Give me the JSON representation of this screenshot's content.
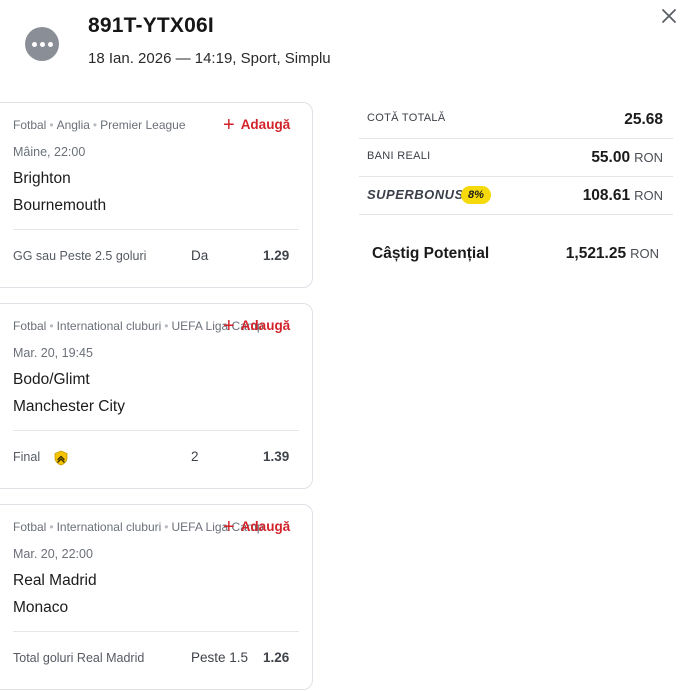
{
  "header": {
    "ticket_id": "891T-YTX06I",
    "subtitle": "18 Ian. 2026 — 14:19, Sport, Simplu"
  },
  "add_label": "Adaugă",
  "bets": [
    {
      "sport": "Fotbal",
      "country": "Anglia",
      "league": "Premier League",
      "time": "Mâine, 22:00",
      "team_a": "Brighton",
      "team_b": "Bournemouth",
      "market": "GG sau Peste 2.5 goluri",
      "pick": "Da",
      "odds": "1.29"
    },
    {
      "sport": "Fotbal",
      "country": "International cluburi",
      "league": "UEFA Liga Camp",
      "time": "Mar. 20, 19:45",
      "team_a": "Bodo/Glimt",
      "team_b": "Manchester City",
      "market": "Final",
      "market_icon": "boost-shield-icon",
      "pick": "2",
      "odds": "1.39"
    },
    {
      "sport": "Fotbal",
      "country": "International cluburi",
      "league": "UEFA Liga Camp",
      "time": "Mar. 20, 22:00",
      "team_a": "Real Madrid",
      "team_b": "Monaco",
      "market": "Total goluri Real Madrid",
      "pick": "Peste 1.5",
      "odds": "1.26"
    }
  ],
  "summary": {
    "cota_label": "COTĂ TOTALĂ",
    "cota_value": "25.68",
    "bani_label": "BANI REALI",
    "bani_value": "55.00",
    "bonus_label": "SUPERBONUS",
    "bonus_badge": "8%",
    "bonus_value": "108.61",
    "currency": "RON",
    "potential_label": "Câștig Potențial",
    "potential_value": "1,521.25"
  },
  "colors": {
    "accent_red": "#d2232a",
    "bonus_yellow": "#f5d90a",
    "avatar_gray": "#8a8e96"
  }
}
